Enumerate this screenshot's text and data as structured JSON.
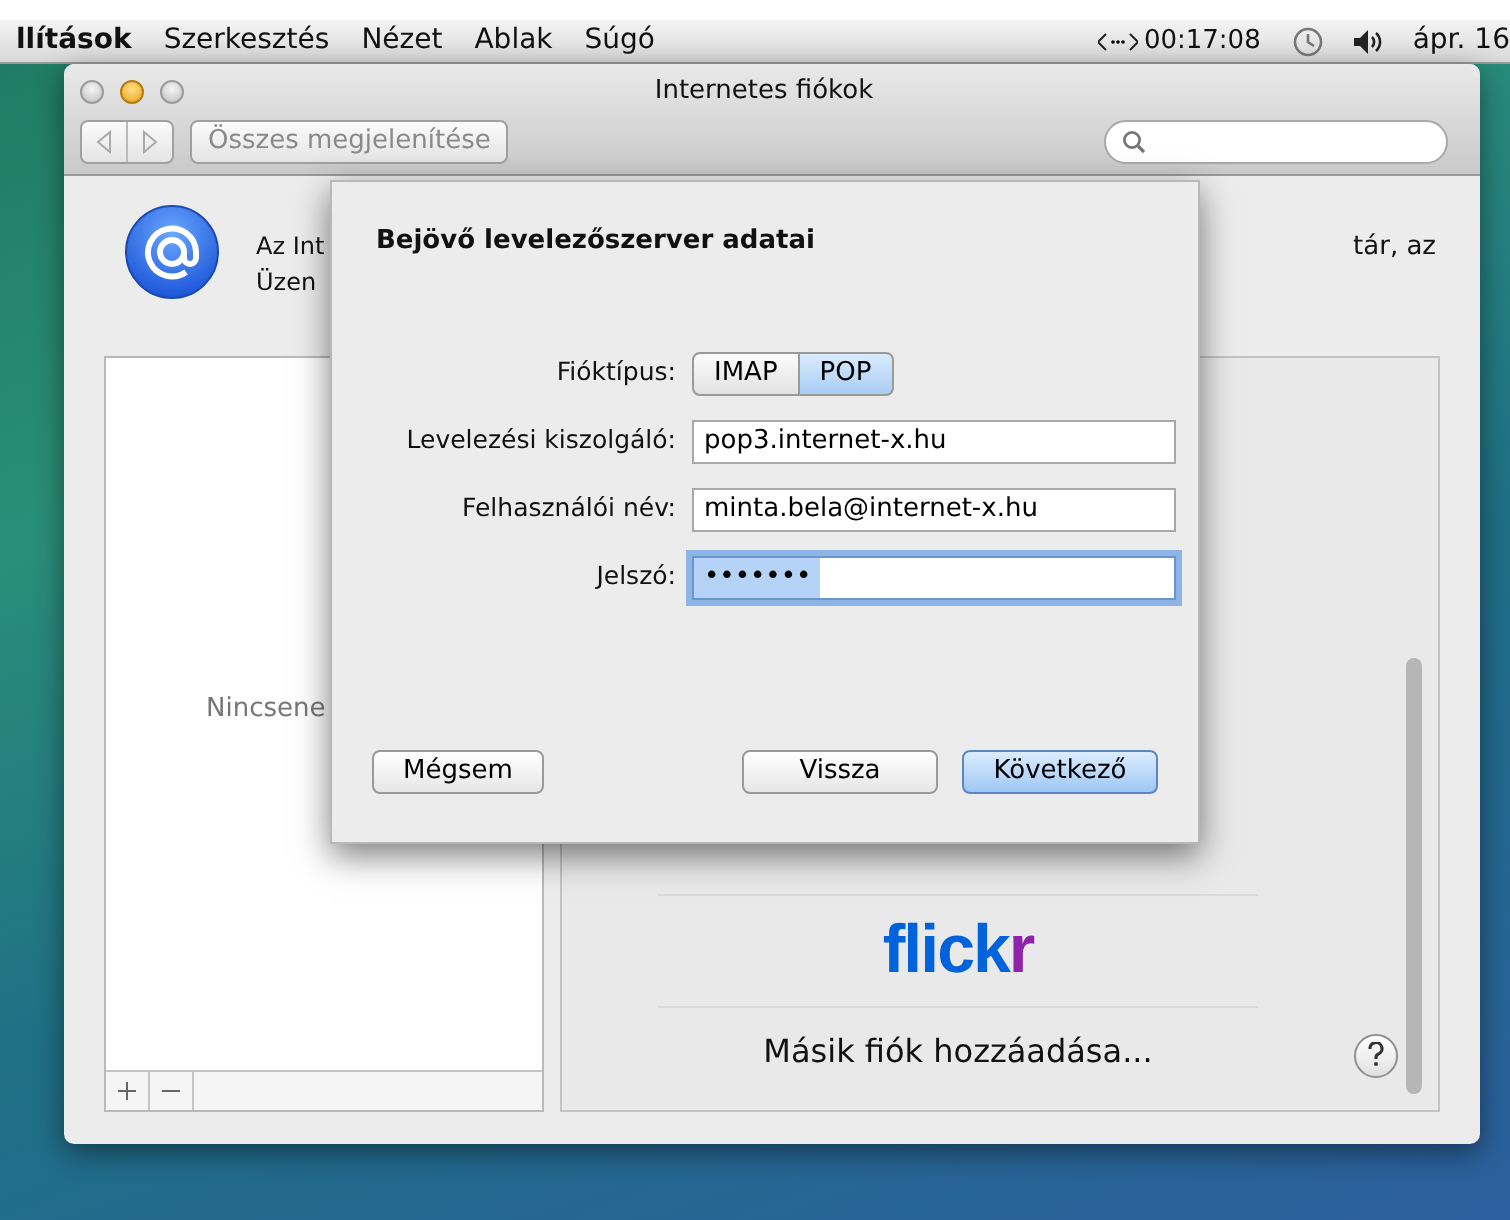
{
  "menu_bar": {
    "items": [
      {
        "label": "llítások",
        "bold": true
      },
      {
        "label": "Szerkesztés",
        "bold": false
      },
      {
        "label": "Nézet",
        "bold": false
      },
      {
        "label": "Ablak",
        "bold": false
      },
      {
        "label": "Súgó",
        "bold": false
      }
    ],
    "clock": "00:17:08",
    "date": "ápr. 16"
  },
  "window": {
    "title": "Internetes fiókok",
    "show_all_button": "Összes megjelenítése"
  },
  "description": {
    "line_1": "Az Int",
    "line_1_end": "tár, az",
    "line_2": "Üzen"
  },
  "accounts_list": {
    "empty_label": "Nincsene"
  },
  "providers": [
    {
      "kind": "logo",
      "label": "flickr"
    },
    {
      "kind": "text",
      "label": "Másik fiók hozzáadása..."
    }
  ],
  "sheet": {
    "title": "Bejövő levelezőszerver adatai",
    "account_type": {
      "label": "Fióktípus:",
      "options": [
        {
          "label": "IMAP",
          "selected": false
        },
        {
          "label": "POP",
          "selected": true
        }
      ]
    },
    "fields": [
      {
        "label": "Levelezési kiszolgáló:",
        "value": "pop3.internet-x.hu",
        "focused": false
      },
      {
        "label": "Felhasználói név:",
        "value": "minta.bela@internet-x.hu",
        "focused": false
      },
      {
        "label": "Jelszó:",
        "value": "•••••••",
        "focused": true
      }
    ],
    "buttons": [
      {
        "label": "Mégsem",
        "default": false
      },
      {
        "label": "Vissza",
        "default": false
      },
      {
        "label": "Következő",
        "default": true
      }
    ]
  }
}
